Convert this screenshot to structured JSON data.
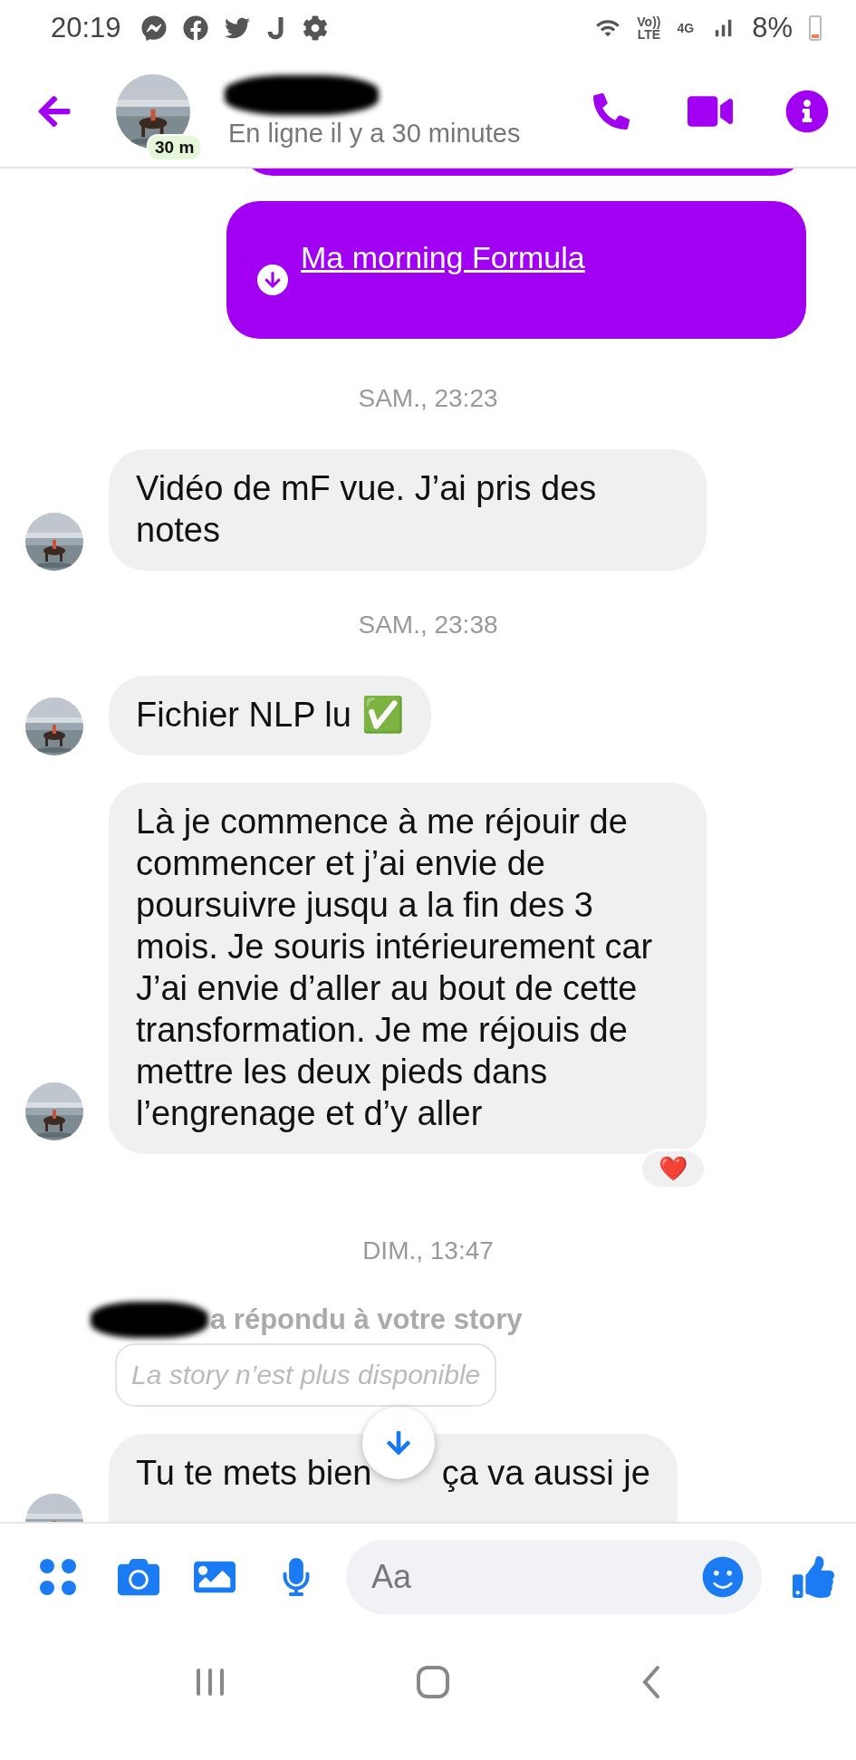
{
  "status_bar": {
    "time": "20:19",
    "volte": "Vo))",
    "lte": "LTE",
    "network": "4G",
    "battery": "8%"
  },
  "header": {
    "status_badge": "30 m",
    "subtitle": "En ligne il y a 30 minutes"
  },
  "messages": [
    {
      "kind": "file",
      "label": "Ma morning Formula"
    },
    {
      "kind": "timestamp",
      "text": "SAM., 23:23"
    },
    {
      "kind": "text",
      "text": "Vidéo de mF vue. J’ai pris des notes"
    },
    {
      "kind": "timestamp",
      "text": "SAM., 23:38"
    },
    {
      "kind": "text",
      "text": "Fichier NLP lu ✅"
    },
    {
      "kind": "text",
      "text": "Là je commence à me réjouir de commencer et j’ai envie de poursuivre jusqu a la fin des 3 mois. Je souris intérieurement car J’ai envie d’aller au bout de cette transformation. Je me réjouis de mettre les deux pieds dans l’engrenage et d’y aller",
      "reaction": "❤️"
    },
    {
      "kind": "timestamp",
      "text": "DIM., 13:47"
    },
    {
      "kind": "story_reply",
      "text": "a répondu à votre story",
      "note": "La story n’est plus disponible"
    },
    {
      "kind": "text",
      "parts": [
        "Tu te mets bien",
        "ça va aussi je"
      ]
    }
  ],
  "composer": {
    "placeholder": "Aa"
  }
}
